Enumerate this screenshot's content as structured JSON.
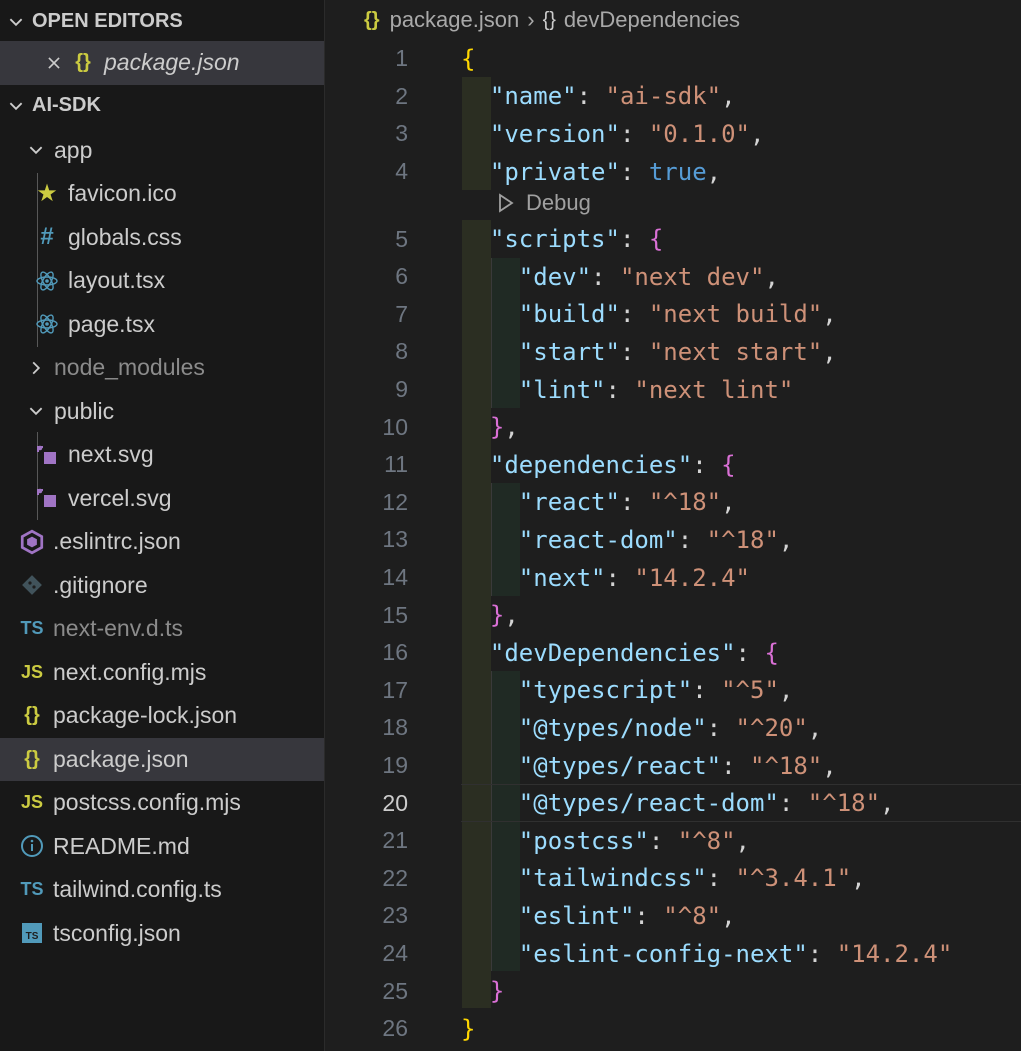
{
  "sidebar": {
    "open_editors_title": "OPEN EDITORS",
    "open_editor_file": "package.json",
    "project_title": "AI-SDK",
    "items": [
      {
        "label": "app",
        "kind": "folder-open",
        "depth": 1
      },
      {
        "label": "favicon.ico",
        "kind": "star-icon",
        "depth": 2
      },
      {
        "label": "globals.css",
        "kind": "hash-icon",
        "depth": 2
      },
      {
        "label": "layout.tsx",
        "kind": "react-icon",
        "depth": 2
      },
      {
        "label": "page.tsx",
        "kind": "react-icon",
        "depth": 2
      },
      {
        "label": "node_modules",
        "kind": "folder-closed",
        "depth": 1,
        "dim": true
      },
      {
        "label": "public",
        "kind": "folder-open",
        "depth": 1
      },
      {
        "label": "next.svg",
        "kind": "svg-icon",
        "depth": 2
      },
      {
        "label": "vercel.svg",
        "kind": "svg-icon",
        "depth": 2
      },
      {
        "label": ".eslintrc.json",
        "kind": "eslint-icon",
        "depth": 1
      },
      {
        "label": ".gitignore",
        "kind": "git-icon",
        "depth": 1
      },
      {
        "label": "next-env.d.ts",
        "kind": "ts-icon",
        "depth": 1,
        "dim": true
      },
      {
        "label": "next.config.mjs",
        "kind": "js-icon",
        "depth": 1
      },
      {
        "label": "package-lock.json",
        "kind": "json-icon",
        "depth": 1
      },
      {
        "label": "package.json",
        "kind": "json-icon",
        "depth": 1,
        "selected": true
      },
      {
        "label": "postcss.config.mjs",
        "kind": "js-icon",
        "depth": 1
      },
      {
        "label": "README.md",
        "kind": "info-icon",
        "depth": 1
      },
      {
        "label": "tailwind.config.ts",
        "kind": "ts-icon",
        "depth": 1
      },
      {
        "label": "tsconfig.json",
        "kind": "tsconfig-icon",
        "depth": 1
      }
    ]
  },
  "editor": {
    "breadcrumb": {
      "file": "package.json",
      "symbol": "devDependencies"
    },
    "codelens": "Debug",
    "active_line": 20,
    "lines": [
      {
        "n": "1",
        "tokens": [
          [
            "br1",
            "{"
          ]
        ]
      },
      {
        "n": "2",
        "tokens": [
          [
            "p",
            "  "
          ],
          [
            "k",
            "\"name\""
          ],
          [
            "p",
            ": "
          ],
          [
            "s",
            "\"ai-sdk\""
          ],
          [
            "p",
            ","
          ]
        ]
      },
      {
        "n": "3",
        "tokens": [
          [
            "p",
            "  "
          ],
          [
            "k",
            "\"version\""
          ],
          [
            "p",
            ": "
          ],
          [
            "s",
            "\"0.1.0\""
          ],
          [
            "p",
            ","
          ]
        ]
      },
      {
        "n": "4",
        "tokens": [
          [
            "p",
            "  "
          ],
          [
            "k",
            "\"private\""
          ],
          [
            "p",
            ": "
          ],
          [
            "b",
            "true"
          ],
          [
            "p",
            ","
          ]
        ]
      },
      {
        "n": "5",
        "tokens": [
          [
            "p",
            "  "
          ],
          [
            "k",
            "\"scripts\""
          ],
          [
            "p",
            ": "
          ],
          [
            "br2",
            "{"
          ]
        ]
      },
      {
        "n": "6",
        "tokens": [
          [
            "p",
            "    "
          ],
          [
            "k",
            "\"dev\""
          ],
          [
            "p",
            ": "
          ],
          [
            "s",
            "\"next dev\""
          ],
          [
            "p",
            ","
          ]
        ]
      },
      {
        "n": "7",
        "tokens": [
          [
            "p",
            "    "
          ],
          [
            "k",
            "\"build\""
          ],
          [
            "p",
            ": "
          ],
          [
            "s",
            "\"next build\""
          ],
          [
            "p",
            ","
          ]
        ]
      },
      {
        "n": "8",
        "tokens": [
          [
            "p",
            "    "
          ],
          [
            "k",
            "\"start\""
          ],
          [
            "p",
            ": "
          ],
          [
            "s",
            "\"next start\""
          ],
          [
            "p",
            ","
          ]
        ]
      },
      {
        "n": "9",
        "tokens": [
          [
            "p",
            "    "
          ],
          [
            "k",
            "\"lint\""
          ],
          [
            "p",
            ": "
          ],
          [
            "s",
            "\"next lint\""
          ]
        ]
      },
      {
        "n": "10",
        "tokens": [
          [
            "p",
            "  "
          ],
          [
            "br2",
            "}"
          ],
          [
            "p",
            ","
          ]
        ]
      },
      {
        "n": "11",
        "tokens": [
          [
            "p",
            "  "
          ],
          [
            "k",
            "\"dependencies\""
          ],
          [
            "p",
            ": "
          ],
          [
            "br2",
            "{"
          ]
        ]
      },
      {
        "n": "12",
        "tokens": [
          [
            "p",
            "    "
          ],
          [
            "k",
            "\"react\""
          ],
          [
            "p",
            ": "
          ],
          [
            "s",
            "\"^18\""
          ],
          [
            "p",
            ","
          ]
        ]
      },
      {
        "n": "13",
        "tokens": [
          [
            "p",
            "    "
          ],
          [
            "k",
            "\"react-dom\""
          ],
          [
            "p",
            ": "
          ],
          [
            "s",
            "\"^18\""
          ],
          [
            "p",
            ","
          ]
        ]
      },
      {
        "n": "14",
        "tokens": [
          [
            "p",
            "    "
          ],
          [
            "k",
            "\"next\""
          ],
          [
            "p",
            ": "
          ],
          [
            "s",
            "\"14.2.4\""
          ]
        ]
      },
      {
        "n": "15",
        "tokens": [
          [
            "p",
            "  "
          ],
          [
            "br2",
            "}"
          ],
          [
            "p",
            ","
          ]
        ]
      },
      {
        "n": "16",
        "tokens": [
          [
            "p",
            "  "
          ],
          [
            "k",
            "\"devDependencies\""
          ],
          [
            "p",
            ": "
          ],
          [
            "br2",
            "{"
          ]
        ]
      },
      {
        "n": "17",
        "tokens": [
          [
            "p",
            "    "
          ],
          [
            "k",
            "\"typescript\""
          ],
          [
            "p",
            ": "
          ],
          [
            "s",
            "\"^5\""
          ],
          [
            "p",
            ","
          ]
        ]
      },
      {
        "n": "18",
        "tokens": [
          [
            "p",
            "    "
          ],
          [
            "k",
            "\"@types/node\""
          ],
          [
            "p",
            ": "
          ],
          [
            "s",
            "\"^20\""
          ],
          [
            "p",
            ","
          ]
        ]
      },
      {
        "n": "19",
        "tokens": [
          [
            "p",
            "    "
          ],
          [
            "k",
            "\"@types/react\""
          ],
          [
            "p",
            ": "
          ],
          [
            "s",
            "\"^18\""
          ],
          [
            "p",
            ","
          ]
        ]
      },
      {
        "n": "20",
        "tokens": [
          [
            "p",
            "    "
          ],
          [
            "k",
            "\"@types/react-dom\""
          ],
          [
            "p",
            ": "
          ],
          [
            "s",
            "\"^18\""
          ],
          [
            "p",
            ","
          ]
        ]
      },
      {
        "n": "21",
        "tokens": [
          [
            "p",
            "    "
          ],
          [
            "k",
            "\"postcss\""
          ],
          [
            "p",
            ": "
          ],
          [
            "s",
            "\"^8\""
          ],
          [
            "p",
            ","
          ]
        ]
      },
      {
        "n": "22",
        "tokens": [
          [
            "p",
            "    "
          ],
          [
            "k",
            "\"tailwindcss\""
          ],
          [
            "p",
            ": "
          ],
          [
            "s",
            "\"^3.4.1\""
          ],
          [
            "p",
            ","
          ]
        ]
      },
      {
        "n": "23",
        "tokens": [
          [
            "p",
            "    "
          ],
          [
            "k",
            "\"eslint\""
          ],
          [
            "p",
            ": "
          ],
          [
            "s",
            "\"^8\""
          ],
          [
            "p",
            ","
          ]
        ]
      },
      {
        "n": "24",
        "tokens": [
          [
            "p",
            "    "
          ],
          [
            "k",
            "\"eslint-config-next\""
          ],
          [
            "p",
            ": "
          ],
          [
            "s",
            "\"14.2.4\""
          ]
        ]
      },
      {
        "n": "25",
        "tokens": [
          [
            "p",
            "  "
          ],
          [
            "br2",
            "}"
          ]
        ]
      },
      {
        "n": "26",
        "tokens": [
          [
            "br1",
            "}"
          ]
        ]
      }
    ]
  },
  "colors": {
    "key": "#9cdcfe",
    "string": "#ce9178",
    "boolean": "#569cd6",
    "bracket_level1": "#ffd700",
    "bracket_level2": "#da70d6",
    "json_icon": "#cbcb41",
    "ts_icon": "#519aba",
    "react_icon": "#519aba",
    "svg_icon": "#a074c4"
  }
}
